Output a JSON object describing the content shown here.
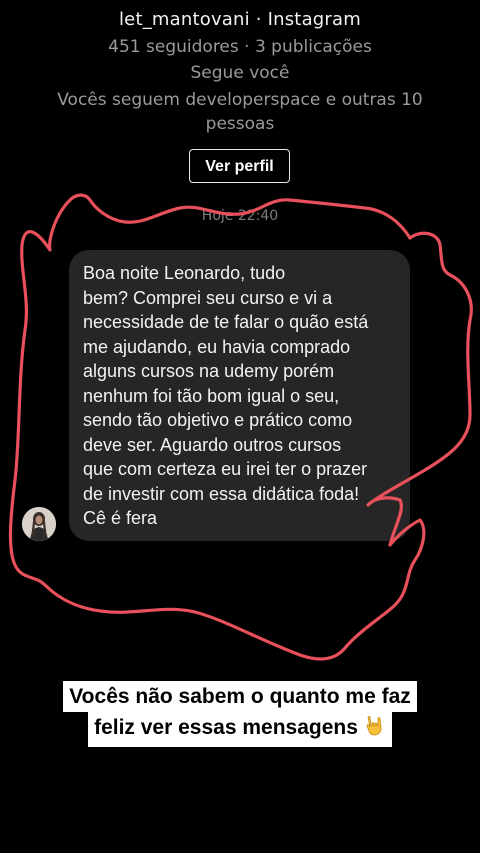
{
  "profile": {
    "title": "let_mantovani · Instagram",
    "stats": "451 seguidores · 3 publicações",
    "follows_you": "Segue você",
    "mutuals": "Vocês seguem developerspace e outras 10 pessoas",
    "view_profile_label": "Ver perfil"
  },
  "thread": {
    "timestamp": "Hoje 22:40",
    "message": "Boa noite Leonardo, tudo\nbem? Comprei seu curso e vi a\nnecessidade de te falar o quão está\nme ajudando, eu havia comprado\nalguns cursos na udemy porém\nnenhum foi tão bom igual o seu,\nsendo tão objetivo e prático como\ndeve ser. Aguardo outros cursos\nque com certeza eu irei ter o prazer\nde investir com essa didática foda!\nCê é fera",
    "avatar_icon": "user-avatar-icon"
  },
  "caption": {
    "line1": "Vocês não sabem o quanto me faz",
    "line2": "feliz ver essas mensagens",
    "emoji_icon": "rock-hand-icon"
  },
  "colors": {
    "background": "#000000",
    "bubble": "#262626",
    "scribble": "#e8505b",
    "muted_text": "#9a9a9a",
    "caption_bg": "#ffffff"
  }
}
